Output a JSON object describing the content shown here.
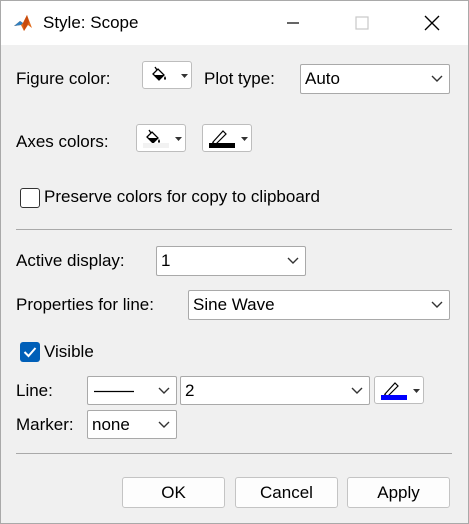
{
  "window": {
    "title": "Style: Scope",
    "controls": {
      "minimize": "minimize",
      "maximize": "maximize",
      "close": "close"
    }
  },
  "figure": {
    "figure_color_label": "Figure color:",
    "plot_type_label": "Plot type:",
    "plot_type_value": "Auto",
    "axes_colors_label": "Axes colors:",
    "axes_background_color": "#ffffff",
    "axes_foreground_color": "#000000",
    "preserve_label": "Preserve colors for copy to clipboard",
    "preserve_checked": false
  },
  "display": {
    "active_display_label": "Active display:",
    "active_display_value": "1",
    "properties_label": "Properties for line:",
    "properties_value": "Sine Wave"
  },
  "line": {
    "visible_label": "Visible",
    "visible_checked": true,
    "line_label": "Line:",
    "line_width": "2",
    "line_color": "#0000ff",
    "marker_label": "Marker:",
    "marker_value": "none"
  },
  "buttons": {
    "ok": "OK",
    "cancel": "Cancel",
    "apply": "Apply"
  },
  "colors": {
    "accent": "#005fb8",
    "window_bg": "#f0f0f0",
    "border": "#a9a9a9"
  }
}
